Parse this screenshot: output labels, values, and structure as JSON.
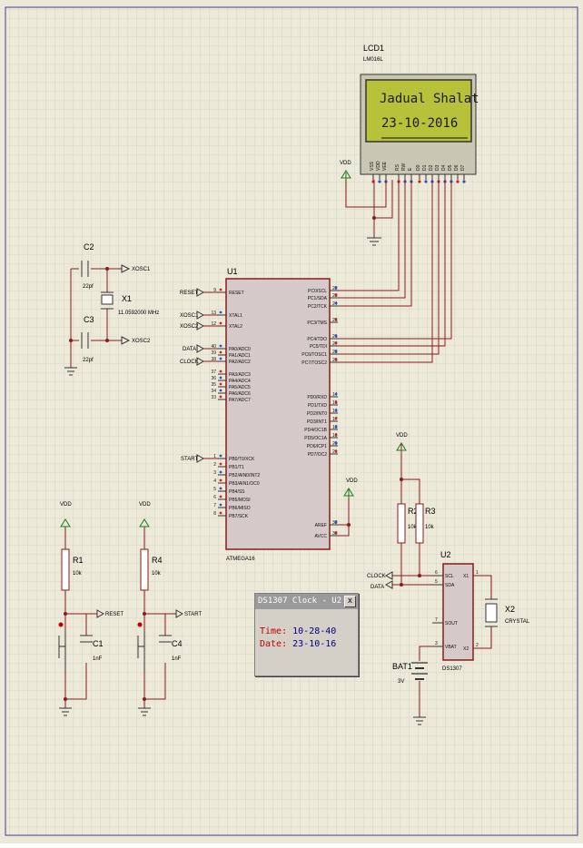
{
  "lcd": {
    "ref": "LCD1",
    "part": "LM016L",
    "line1": "Jadual Shalat",
    "line2": "23-10-2016",
    "pins": [
      "VSS",
      "VDD",
      "VEE",
      "RS",
      "RW",
      "E",
      "D0",
      "D1",
      "D2",
      "D3",
      "D4",
      "D5",
      "D6",
      "D7"
    ]
  },
  "mcu": {
    "ref": "U1",
    "part": "ATMEGA16",
    "left_pins": [
      {
        "num": "9",
        "name": "RESET"
      },
      {
        "num": "13",
        "name": "XTAL1"
      },
      {
        "num": "12",
        "name": "XTAL2"
      },
      {
        "num": "40",
        "name": "PA0/ADC0"
      },
      {
        "num": "39",
        "name": "PA1/ADC1"
      },
      {
        "num": "38",
        "name": "PA2/ADC2"
      },
      {
        "num": "37",
        "name": "PA3/ADC3"
      },
      {
        "num": "36",
        "name": "PA4/ADC4"
      },
      {
        "num": "35",
        "name": "PA5/ADC5"
      },
      {
        "num": "34",
        "name": "PA6/ADC6"
      },
      {
        "num": "33",
        "name": "PA7/ADC7"
      },
      {
        "num": "1",
        "name": "PB0/T0/XCK"
      },
      {
        "num": "2",
        "name": "PB1/T1"
      },
      {
        "num": "3",
        "name": "PB2/AIN0/INT2"
      },
      {
        "num": "4",
        "name": "PB3/AIN1/OC0"
      },
      {
        "num": "5",
        "name": "PB4/SS"
      },
      {
        "num": "6",
        "name": "PB5/MOSI"
      },
      {
        "num": "7",
        "name": "PB6/MISO"
      },
      {
        "num": "8",
        "name": "PB7/SCK"
      }
    ],
    "right_pins": [
      {
        "num": "22",
        "name": "PC0/SCL"
      },
      {
        "num": "23",
        "name": "PC1/SDA"
      },
      {
        "num": "24",
        "name": "PC2/TCK"
      },
      {
        "num": "25",
        "name": "PC3/TMS"
      },
      {
        "num": "26",
        "name": "PC4/TDO"
      },
      {
        "num": "27",
        "name": "PC5/TDI"
      },
      {
        "num": "28",
        "name": "PC6/TOSC1"
      },
      {
        "num": "29",
        "name": "PC7/TOSC2"
      },
      {
        "num": "14",
        "name": "PD0/RXD"
      },
      {
        "num": "15",
        "name": "PD1/TXD"
      },
      {
        "num": "16",
        "name": "PD2/INT0"
      },
      {
        "num": "17",
        "name": "PD3/INT1"
      },
      {
        "num": "18",
        "name": "PD4/OC1B"
      },
      {
        "num": "19",
        "name": "PD5/OC1A"
      },
      {
        "num": "20",
        "name": "PD6/ICP1"
      },
      {
        "num": "21",
        "name": "PD7/OC2"
      },
      {
        "num": "32",
        "name": "AREF"
      },
      {
        "num": "30",
        "name": "AVCC"
      }
    ]
  },
  "crystal1": {
    "ref": "X1",
    "value": "11.0592000 MHz"
  },
  "c2": {
    "ref": "C2",
    "value": "22pf"
  },
  "c3": {
    "ref": "C3",
    "value": "22pf"
  },
  "xosc1": "XOSC1",
  "xosc2": "XOSC2",
  "net_reset": "RESET",
  "net_data": "DATA",
  "net_clock": "CLOCK",
  "net_start": "START",
  "vdd": "VDD",
  "r1": {
    "ref": "R1",
    "value": "10k"
  },
  "r4": {
    "ref": "R4",
    "value": "10k"
  },
  "r2": {
    "ref": "R2",
    "value": "10k"
  },
  "r3": {
    "ref": "R3",
    "value": "10k"
  },
  "c1": {
    "ref": "C1",
    "value": "1nF"
  },
  "c4": {
    "ref": "C4",
    "value": "1nF"
  },
  "rtc": {
    "ref": "U2",
    "part": "DS1307",
    "pin_scl": "SCL",
    "pin_sda": "SDA",
    "pin_sout": "SOUT",
    "pin_vbat": "VBAT",
    "pin_x1": "X1",
    "pin_x2": "X2",
    "num_scl": "6",
    "num_sda": "5",
    "num_sout": "7",
    "num_vbat": "3",
    "num_x1": "1",
    "num_x2": "2"
  },
  "crystal2": {
    "ref": "X2",
    "value": "CRYSTAL"
  },
  "bat": {
    "ref": "BAT1",
    "value": "3V"
  },
  "popup": {
    "title": "DS1307 Clock - U2",
    "close": "x",
    "time_label": "Time:",
    "time_value": "10-28-40",
    "date_label": "Date:",
    "date_value": "23-10-16"
  },
  "colors": {
    "sheet": "#ece9d8",
    "grid": "#c5c9b7",
    "border": "#5a5aa0",
    "wire": "#8b1a1a",
    "ic_fill": "#d6c9c9",
    "lcd_glass": "#b7c13a",
    "vdd_green": "#1f7a1f",
    "pin_blue": "#3050d0",
    "pin_red": "#d02020"
  }
}
